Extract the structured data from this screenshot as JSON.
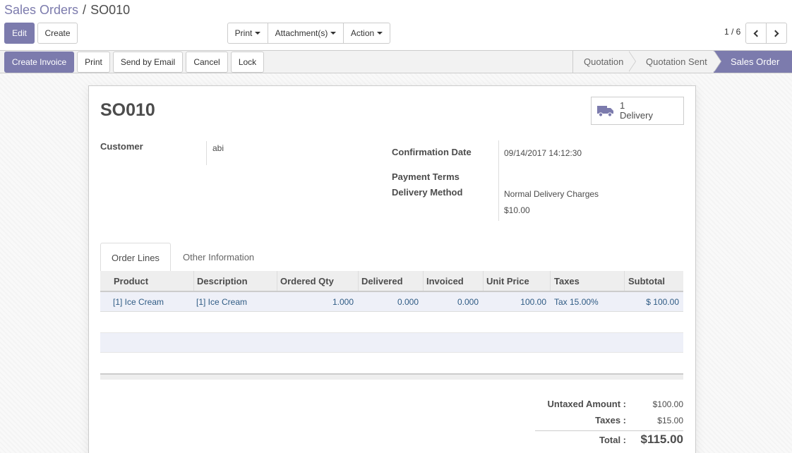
{
  "breadcrumb": {
    "parent": "Sales Orders",
    "separator": "/",
    "current": "SO010"
  },
  "toolbar": {
    "edit_label": "Edit",
    "create_label": "Create",
    "print_label": "Print",
    "attachments_label": "Attachment(s)",
    "action_label": "Action"
  },
  "pager": {
    "value": "1 / 6"
  },
  "statusbar": {
    "buttons": [
      "Create Invoice",
      "Print",
      "Send by Email",
      "Cancel",
      "Lock"
    ],
    "stages": [
      "Quotation",
      "Quotation Sent",
      "Sales Order"
    ],
    "active_stage": "Sales Order"
  },
  "form": {
    "title": "SO010",
    "delivery_count": "1",
    "delivery_label": "Delivery",
    "customer_label": "Customer",
    "customer_value": "abi",
    "confirmation_date_label": "Confirmation Date",
    "confirmation_date_value": "09/14/2017 14:12:30",
    "payment_terms_label": "Payment Terms",
    "delivery_method_label": "Delivery Method",
    "delivery_method_value": "Normal Delivery Charges",
    "delivery_method_price": "$10.00"
  },
  "tabs": [
    "Order Lines",
    "Other Information"
  ],
  "table": {
    "columns": [
      "Product",
      "Description",
      "Ordered Qty",
      "Delivered",
      "Invoiced",
      "Unit Price",
      "Taxes",
      "Subtotal"
    ],
    "rows": [
      [
        "[1] Ice Cream",
        "[1] Ice Cream",
        "1.000",
        "0.000",
        "0.000",
        "100.00",
        "Tax 15.00%",
        "$ 100.00"
      ]
    ]
  },
  "totals": {
    "untaxed_label": "Untaxed Amount :",
    "untaxed_value": "$100.00",
    "taxes_label": "Taxes :",
    "taxes_value": "$15.00",
    "total_label": "Total :",
    "total_value": "$115.00"
  },
  "colors": {
    "accent": "#7c7bad",
    "link": "#2f5b84"
  }
}
